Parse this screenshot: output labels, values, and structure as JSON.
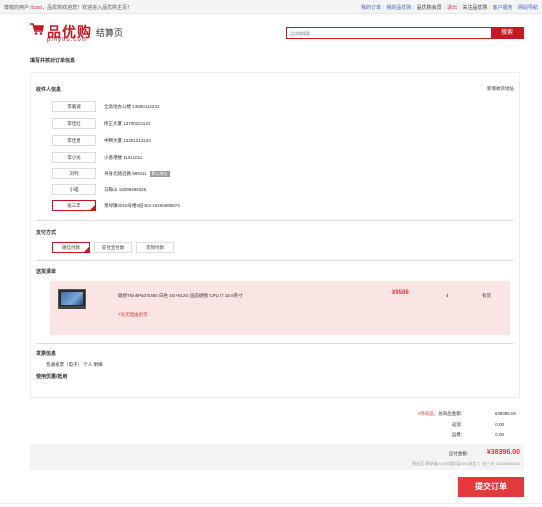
{
  "topbar": {
    "greet_prefix": "尊敬的用户",
    "user": "itcast",
    "greet_suffix": "，品优购欢迎您！欢迎进入品优购主页！",
    "links": [
      {
        "label": "我的订单",
        "style": "blue"
      },
      {
        "label": "我的品优购",
        "style": "blue"
      },
      {
        "label": "品优购会员",
        "style": "dark"
      },
      {
        "label": "退出",
        "style": "red"
      },
      {
        "label": "关注品优购",
        "style": "dark"
      },
      {
        "label": "客户服务",
        "style": "blue"
      },
      {
        "label": "网站导航",
        "style": "blue"
      }
    ]
  },
  "header": {
    "brand": "品优购",
    "pinyin": "pinyou.com",
    "page_title": "结算页",
    "search_placeholder": "品优购搜索",
    "search_button": "搜索"
  },
  "main": {
    "heading": "填写并核对订单信息"
  },
  "address": {
    "title": "收件人信息",
    "new_link": "新增收货地址",
    "items": [
      {
        "name": "李嘉诚",
        "detail": "全高地办公楼 13900112222",
        "default": false,
        "selected": false
      },
      {
        "name": "李佳红",
        "detail": "修正大厦 13700221122",
        "default": false,
        "selected": false
      },
      {
        "name": "李佳星",
        "detail": "中腾大厦 13301212233",
        "default": false,
        "selected": false
      },
      {
        "name": "李小龙",
        "detail": "小香港楼 11011011",
        "default": false,
        "selected": false
      },
      {
        "name": "刘列",
        "detail": "寻身北随沼路 999111",
        "default": true,
        "default_label": "默认地址",
        "selected": false
      },
      {
        "name": "小喵",
        "detail": "马鞍山 18299496325",
        "default": false,
        "selected": false
      },
      {
        "name": "张三丰",
        "detail": "莱绿镇2015号楼3层404 15265965874",
        "default": false,
        "selected": true
      }
    ]
  },
  "payment": {
    "title": "支付方式",
    "options": [
      {
        "label": "微信付款",
        "selected": true
      },
      {
        "label": "支付宝付款",
        "selected": false
      },
      {
        "label": "货到付款",
        "selected": false
      }
    ]
  },
  "items": {
    "title": "送货清单",
    "list": [
      {
        "name": "联想ThinkPad E480 白色 4G+512G 固态硬盘 CPU i7 15.6英寸",
        "price": "¥9599",
        "qty": "4",
        "stock": "有货",
        "notice": "7天无理由退货"
      }
    ]
  },
  "invoice": {
    "title": "发票信息",
    "value": "普通发票（电子） 个人 明细",
    "coupon_title": "使用优惠/抵用"
  },
  "summary": {
    "count_prefix": "4件商品，",
    "count_label": "总商品金额:",
    "total_goods": "¥38396.00",
    "rebate_label": "返现:",
    "rebate": "0.00",
    "shipping_label": "运费:",
    "shipping": "0.00",
    "payable_label": "应付金额:",
    "payable": "¥38396.00",
    "ship_to": "寄送至:莱绿镇2015号楼3层404 收货人: 张三丰 15265965874",
    "submit": "提交订单"
  },
  "colors": {
    "accent": "#c81623",
    "submit": "#e4393c",
    "item_bg": "#fbe4e4"
  }
}
